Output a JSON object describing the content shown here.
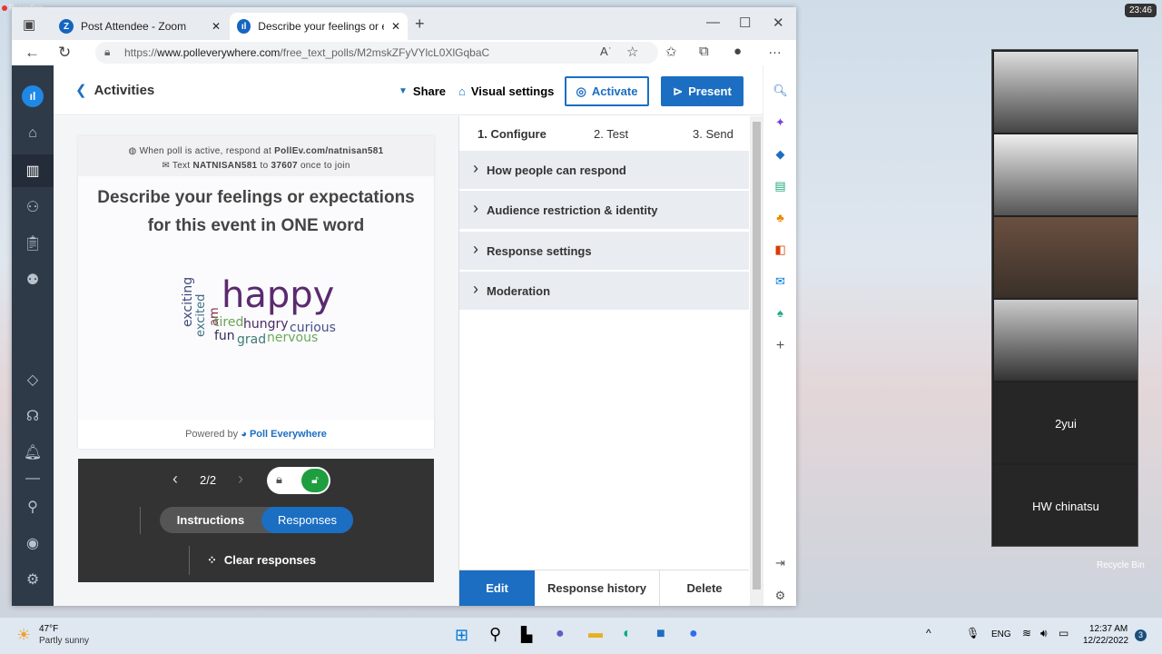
{
  "recording": "Recording",
  "clock": "23:46",
  "browser": {
    "tabs": [
      {
        "title": "Post Attendee - Zoom",
        "icon": "zoom-icon"
      },
      {
        "title": "Describe your feelings or expecta",
        "icon": "polleverywhere-icon"
      }
    ],
    "url_prefix": "https://",
    "url_host": "www.polleverywhere.com",
    "url_path": "/free_text_polls/M2mskZFyVYlcL0XlGqbaC"
  },
  "header": {
    "back": "Activities",
    "share": "Share",
    "visual": "Visual settings",
    "activate": "Activate",
    "present": "Present"
  },
  "slide": {
    "inst1_a": "When poll is active, respond at ",
    "inst1_b": "PollEv.com/natnisan581",
    "inst2_a": "Text ",
    "inst2_b": "NATNISAN581",
    "inst2_c": " to ",
    "inst2_d": "37607",
    "inst2_e": " once to join",
    "question": "Describe your feelings or expectations for this event in ONE word",
    "words": [
      {
        "text": "happy",
        "color": "#5b2a6e"
      },
      {
        "text": "exciting",
        "color": "#3f4a7a"
      },
      {
        "text": "excited",
        "color": "#3d6e80"
      },
      {
        "text": "am",
        "color": "#7a2b45"
      },
      {
        "text": "tired",
        "color": "#6aa456"
      },
      {
        "text": "hungry",
        "color": "#4a2a66"
      },
      {
        "text": "curious",
        "color": "#45508a"
      },
      {
        "text": "fun",
        "color": "#2e2e5a"
      },
      {
        "text": "grad",
        "color": "#3e7a78"
      },
      {
        "text": "nervous",
        "color": "#6aaa5a"
      }
    ],
    "powered": "Powered by",
    "brand": "Poll Everywhere"
  },
  "controls": {
    "page": "2/2",
    "instructions": "Instructions",
    "responses": "Responses",
    "clear": "Clear responses",
    "lock_state": "unlocked"
  },
  "config": {
    "steps": [
      "1. Configure",
      "2. Test",
      "3. Send"
    ],
    "sections": [
      "How people can respond",
      "Audience restriction & identity",
      "Response settings",
      "Moderation"
    ],
    "footer": [
      "Edit",
      "Response history",
      "Delete"
    ]
  },
  "gallery": {
    "names": [
      "2yui",
      "HW chinatsu"
    ]
  },
  "desktop": {
    "recycle": "Recycle Bin"
  },
  "taskbar": {
    "temp": "47°F",
    "weather": "Partly sunny",
    "lang": "ENG",
    "time": "12:37 AM",
    "date": "12/22/2022",
    "badge": "3"
  }
}
